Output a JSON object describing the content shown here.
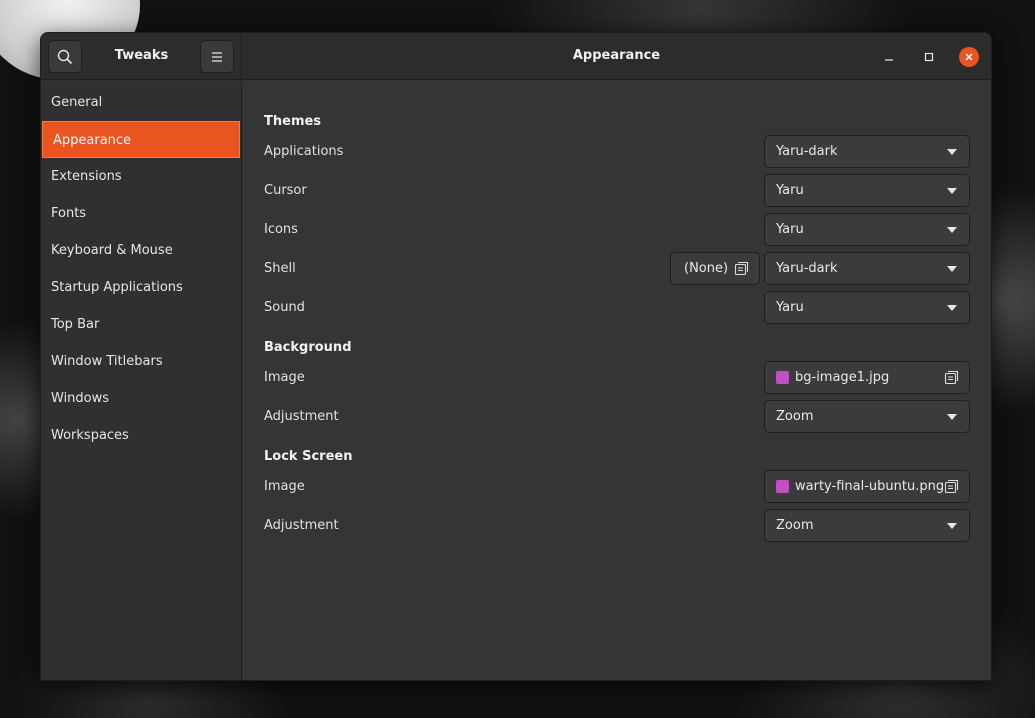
{
  "header": {
    "app_title": "Tweaks",
    "page_title": "Appearance",
    "icons": [
      "search-icon",
      "hamburger-menu-icon",
      "minimize-icon",
      "maximize-icon",
      "close-icon"
    ],
    "close_color": "#e95420"
  },
  "sidebar": {
    "items": [
      {
        "label": "General"
      },
      {
        "label": "Appearance"
      },
      {
        "label": "Extensions"
      },
      {
        "label": "Fonts"
      },
      {
        "label": "Keyboard & Mouse"
      },
      {
        "label": "Startup Applications"
      },
      {
        "label": "Top Bar"
      },
      {
        "label": "Window Titlebars"
      },
      {
        "label": "Windows"
      },
      {
        "label": "Workspaces"
      }
    ],
    "selected": "Appearance",
    "accent_color": "#e95420"
  },
  "themes": {
    "heading": "Themes",
    "applications": {
      "label": "Applications",
      "value": "Yaru-dark"
    },
    "cursor": {
      "label": "Cursor",
      "value": "Yaru"
    },
    "icons": {
      "label": "Icons",
      "value": "Yaru"
    },
    "shell": {
      "label": "Shell",
      "file_value": "(None)",
      "value": "Yaru-dark"
    },
    "sound": {
      "label": "Sound",
      "value": "Yaru"
    }
  },
  "background": {
    "heading": "Background",
    "image": {
      "label": "Image",
      "value": "bg-image1.jpg"
    },
    "adjustment": {
      "label": "Adjustment",
      "value": "Zoom"
    }
  },
  "lock_screen": {
    "heading": "Lock Screen",
    "image": {
      "label": "Image",
      "value": "warty-final-ubuntu.png"
    },
    "adjustment": {
      "label": "Adjustment",
      "value": "Zoom"
    }
  }
}
